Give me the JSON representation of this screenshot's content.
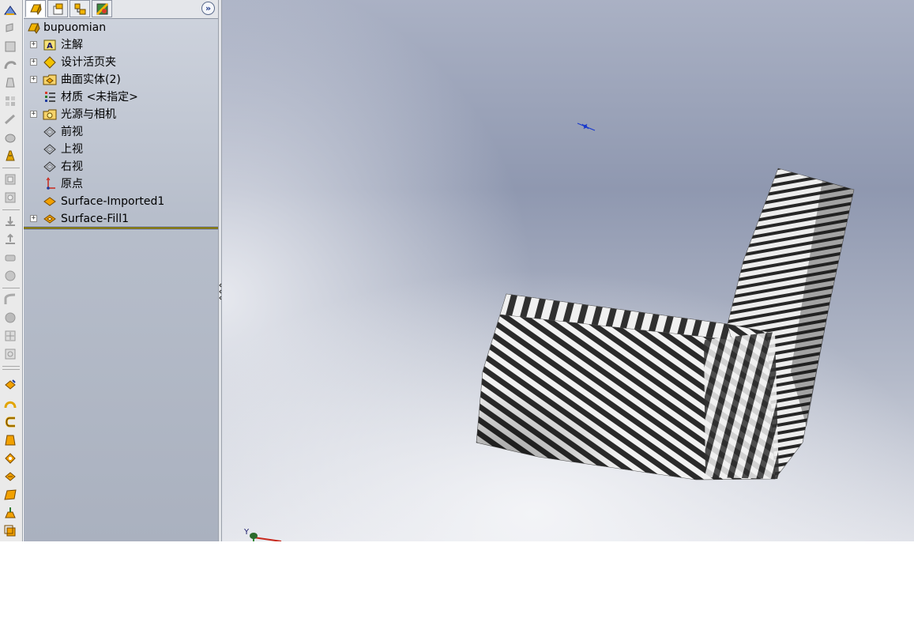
{
  "feature_manager": {
    "tabs": [
      {
        "name": "feature-manager-tab",
        "icon": "part-icon"
      },
      {
        "name": "property-manager-tab",
        "icon": "properties-icon"
      },
      {
        "name": "configuration-manager-tab",
        "icon": "configuration-icon"
      },
      {
        "name": "display-manager-tab",
        "icon": "appearance-icon"
      }
    ],
    "root_label": "bupuomian",
    "tree": [
      {
        "label": "注解",
        "icon": "annotations-icon",
        "expandable": true
      },
      {
        "label": "设计活页夹",
        "icon": "design-binder-icon",
        "expandable": true
      },
      {
        "label": "曲面实体(2)",
        "icon": "surface-bodies-icon",
        "expandable": true
      },
      {
        "label": "材质 <未指定>",
        "icon": "material-icon",
        "expandable": false
      },
      {
        "label": "光源与相机",
        "icon": "lights-cameras-icon",
        "expandable": true
      },
      {
        "label": "前视",
        "icon": "plane-icon",
        "expandable": false
      },
      {
        "label": "上视",
        "icon": "plane-icon",
        "expandable": false
      },
      {
        "label": "右视",
        "icon": "plane-icon",
        "expandable": false
      },
      {
        "label": "原点",
        "icon": "origin-icon",
        "expandable": false
      },
      {
        "label": "Surface-Imported1",
        "icon": "imported-surface-icon",
        "expandable": false
      },
      {
        "label": "Surface-Fill1",
        "icon": "filled-surface-icon",
        "expandable": true
      }
    ]
  },
  "graphics": {
    "triad_label": "Y",
    "zebra_colors": {
      "dark": "#2a2a2a",
      "light": "#f2f2f2"
    }
  },
  "colors": {
    "rollback_bar": "#d8c200",
    "accent_blue": "#1f3a8a"
  }
}
